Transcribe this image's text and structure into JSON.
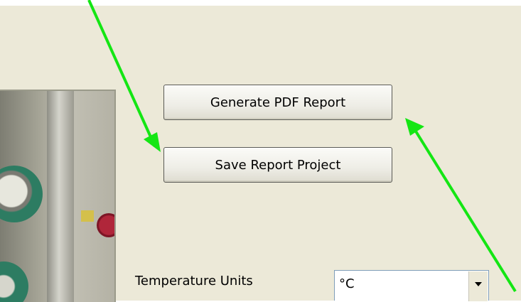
{
  "buttons": {
    "generate_pdf_label": "Generate PDF Report",
    "save_project_label": "Save Report Project"
  },
  "settings": {
    "temperature_units_label": "Temperature Units",
    "temperature_units_value": "°C"
  },
  "colors": {
    "panel_background": "#ece9d8",
    "annotation_arrow": "#14e614"
  },
  "icons": {
    "dropdown": "chevron-down-icon"
  }
}
